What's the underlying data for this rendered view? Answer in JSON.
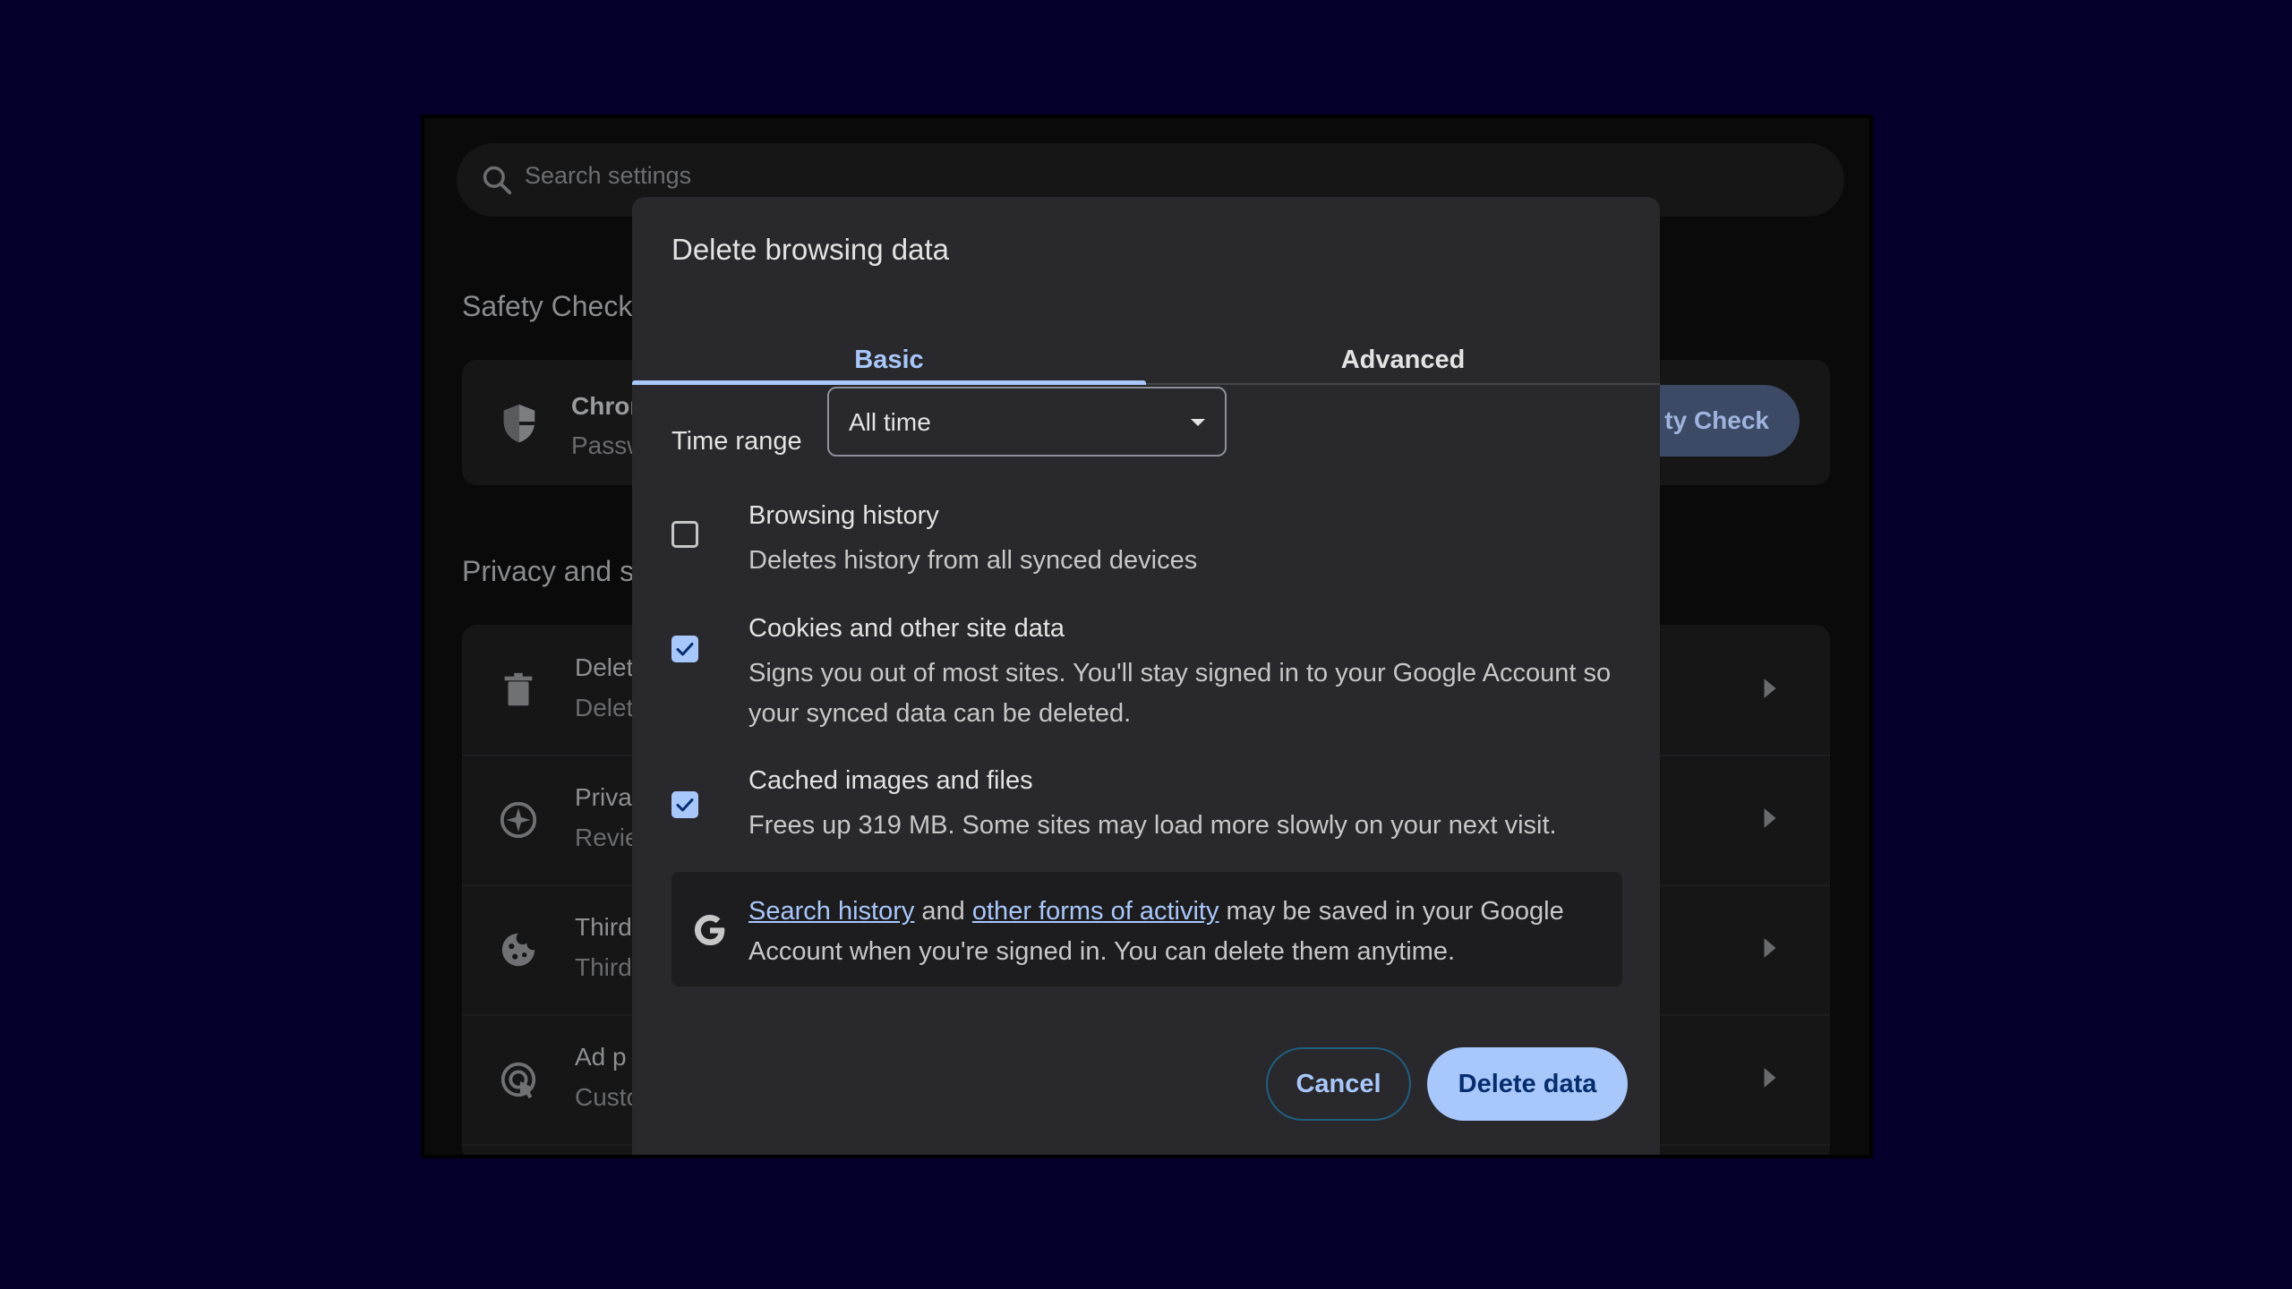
{
  "background": {
    "search": {
      "placeholder": "Search settings",
      "icon": "search-icon"
    },
    "safety_check": {
      "title": "Safety Check",
      "row_title": "Chron",
      "row_sub": "Passw",
      "button_label": "ty Check"
    },
    "privacy": {
      "title": "Privacy and s",
      "rows": [
        {
          "icon": "trash-icon",
          "title": "Delet",
          "sub": "Delet"
        },
        {
          "icon": "compass-icon",
          "title": "Priva",
          "sub": "Revie"
        },
        {
          "icon": "cookie-icon",
          "title": "Third",
          "sub": "Third"
        },
        {
          "icon": "ad-privacy-icon",
          "title": "Ad p",
          "sub": "Custo"
        }
      ]
    }
  },
  "dialog": {
    "title": "Delete browsing data",
    "tabs": [
      {
        "label": "Basic",
        "active": true
      },
      {
        "label": "Advanced",
        "active": false
      }
    ],
    "time_range": {
      "label": "Time range",
      "value": "All time"
    },
    "items": [
      {
        "title": "Browsing history",
        "desc": "Deletes history from all synced devices",
        "checked": false
      },
      {
        "title": "Cookies and other site data",
        "desc": "Signs you out of most sites. You'll stay signed in to your Google Account so your synced data can be deleted.",
        "checked": true
      },
      {
        "title": "Cached images and files",
        "desc": "Frees up 319 MB. Some sites may load more slowly on your next visit.",
        "checked": true
      }
    ],
    "google_notice": {
      "link1": "Search history",
      "and": "and",
      "link2": "other forms of activity",
      "rest": "may be saved in your Google Account when you're signed in. You can delete them anytime."
    },
    "buttons": {
      "cancel": "Cancel",
      "delete": "Delete data"
    }
  },
  "colors": {
    "accent": "#a8c7fa",
    "dialog_bg": "#29292d",
    "page_bg": "#05002b",
    "delete_text": "#062e6f"
  }
}
